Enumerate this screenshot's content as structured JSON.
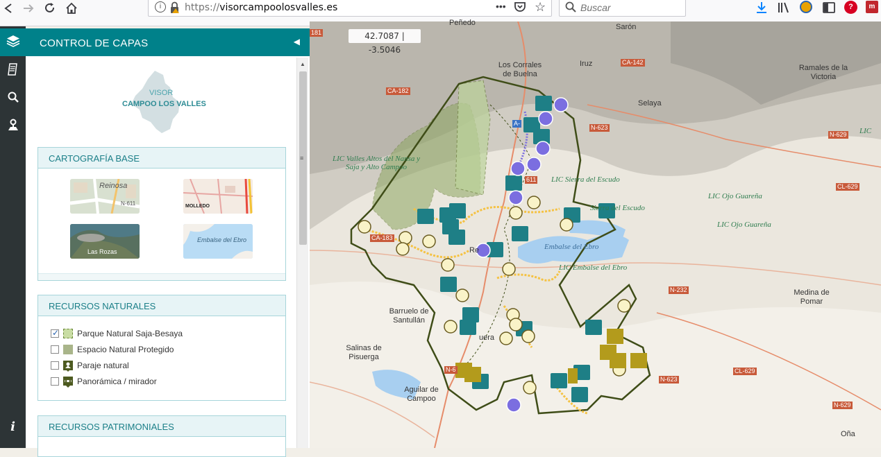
{
  "browser": {
    "url_scheme": "https://",
    "url_host": "visorcampoolosvalles.es",
    "search_placeholder": "Buscar",
    "menu_dots": "•••"
  },
  "panel": {
    "title": "CONTROL DE CAPAS",
    "logo_line1": "VISOR",
    "logo_line2": "CAMPOO LOS VALLES"
  },
  "cartografia": {
    "header": "CARTOGRAFÍA BASE",
    "thumbs": [
      {
        "label": "Reinosa",
        "sub": "N-611"
      },
      {
        "label": "MOLLEDO",
        "sub": ""
      },
      {
        "label": "Las Rozas",
        "sub": ""
      },
      {
        "label": "Embalse del Ebro",
        "sub": ""
      }
    ]
  },
  "naturales": {
    "header": "RECURSOS NATURALES",
    "items": [
      {
        "label": "Parque Natural Saja-Besaya",
        "checked": true,
        "color": "#b8d48f"
      },
      {
        "label": "Espacio Natural Protegido",
        "checked": false,
        "color": "#a9b58a"
      },
      {
        "label": "Paraje natural",
        "checked": false,
        "color": "#5c6b28"
      },
      {
        "label": "Panorámica / mirador",
        "checked": false,
        "color": "#5c6b28"
      }
    ]
  },
  "patrimoniales": {
    "header": "RECURSOS PATRIMONIALES"
  },
  "map": {
    "coords": "42.7087 | -3.5046",
    "places": [
      "Peñedo",
      "Sarón",
      "Los Corrales de Buelna",
      "Iruz",
      "Ramales de la Victoria",
      "Selaya",
      "Barruelo de Santullán",
      "Salinas de Pisuerga",
      "Aguilar de Campoo",
      "Medina de Pomar",
      "Oña",
      "Re",
      "uera"
    ],
    "lics": [
      "LIC Valles Altos del Nansa y Saja y Alto Campoo",
      "LIC Sierra del Escudo",
      "LIC Ojo Guareña",
      "LIC Ojo Guareña",
      "LIC Embalse del Ebro",
      "LIC",
      "Sierra del Escudo"
    ],
    "water": [
      "Embalse del Ebro"
    ],
    "roads": [
      "CA-182",
      "CA-142",
      "N-623",
      "N-629",
      "CL-629",
      "N-232",
      "CA-183",
      "N-623",
      "CL-629",
      "N-629",
      "A-",
      "611",
      "N-6",
      "181"
    ]
  },
  "colors": {
    "accent": "#00818a",
    "strip": "#2d3436",
    "poi": "#1e7f86",
    "trail": "#f5c242",
    "walk": "#7b6ee0",
    "heritage": "#b39b1c"
  }
}
